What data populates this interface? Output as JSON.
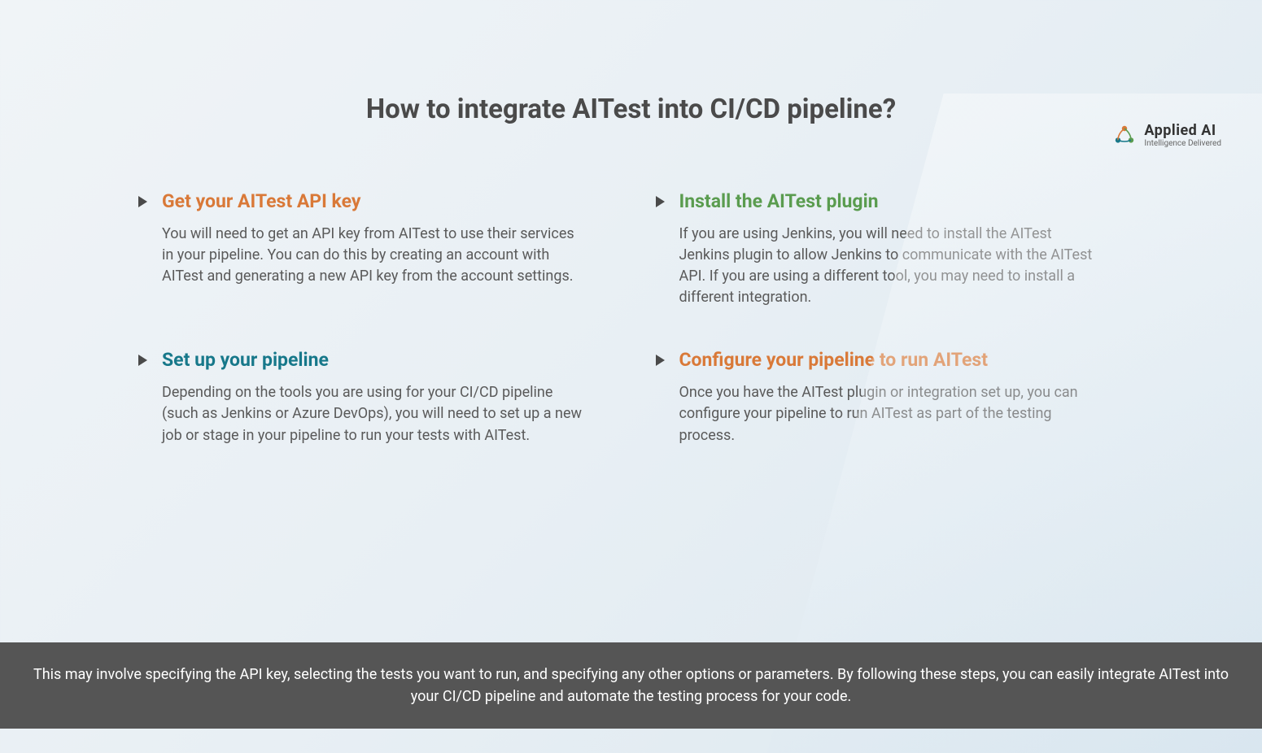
{
  "logo": {
    "name": "Applied AI",
    "tagline": "Intelligence Delivered"
  },
  "title": "How to integrate AITest into CI/CD pipeline?",
  "items": [
    {
      "heading": "Get your AITest API key",
      "body": "You will need to get an API key from AITest to use their services in your pipeline. You can do this by creating an account with AITest and generating a new API key from the account settings."
    },
    {
      "heading": "Install the AITest plugin",
      "body": "If you are using Jenkins, you will need to install the AITest Jenkins plugin to allow Jenkins to communicate with the AITest API. If you are using a different tool, you may need to install a different integration."
    },
    {
      "heading": "Set up your pipeline",
      "body": "Depending on the tools you are using for your CI/CD pipeline (such as Jenkins or Azure DevOps), you will need to set up a new job or stage in your pipeline to run your tests with AITest."
    },
    {
      "heading": "Configure your pipeline to run AITest",
      "body": "Once you have the AITest plugin or integration set up, you can configure your pipeline to run AITest as part of the testing process."
    }
  ],
  "footer": "This may involve specifying the API key, selecting the tests you want to run, and specifying any other options or parameters. By following these steps, you can easily integrate AITest into your CI/CD pipeline and automate the testing process for your code."
}
